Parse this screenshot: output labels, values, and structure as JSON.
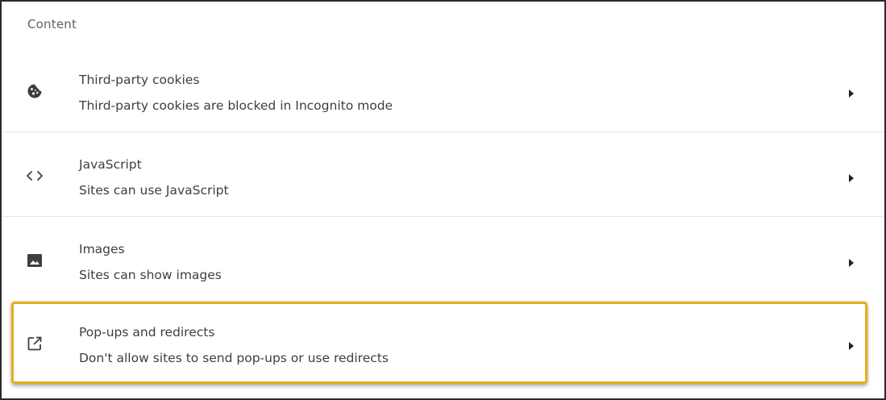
{
  "section": {
    "title": "Content"
  },
  "rows": [
    {
      "icon": "cookie-icon",
      "title": "Third-party cookies",
      "subtitle": "Third-party cookies are blocked in Incognito mode"
    },
    {
      "icon": "code-icon",
      "title": "JavaScript",
      "subtitle": "Sites can use JavaScript"
    },
    {
      "icon": "image-icon",
      "title": "Images",
      "subtitle": "Sites can show images"
    },
    {
      "icon": "open-in-new-icon",
      "title": "Pop-ups and redirects",
      "subtitle": "Don't allow sites to send pop-ups or use redirects",
      "highlighted": true
    }
  ],
  "colors": {
    "highlight_border": "#e3ae21",
    "icon": "#3c4043",
    "text": "#3c4043",
    "section_title": "#5f6368",
    "divider": "#e6e6e6"
  }
}
